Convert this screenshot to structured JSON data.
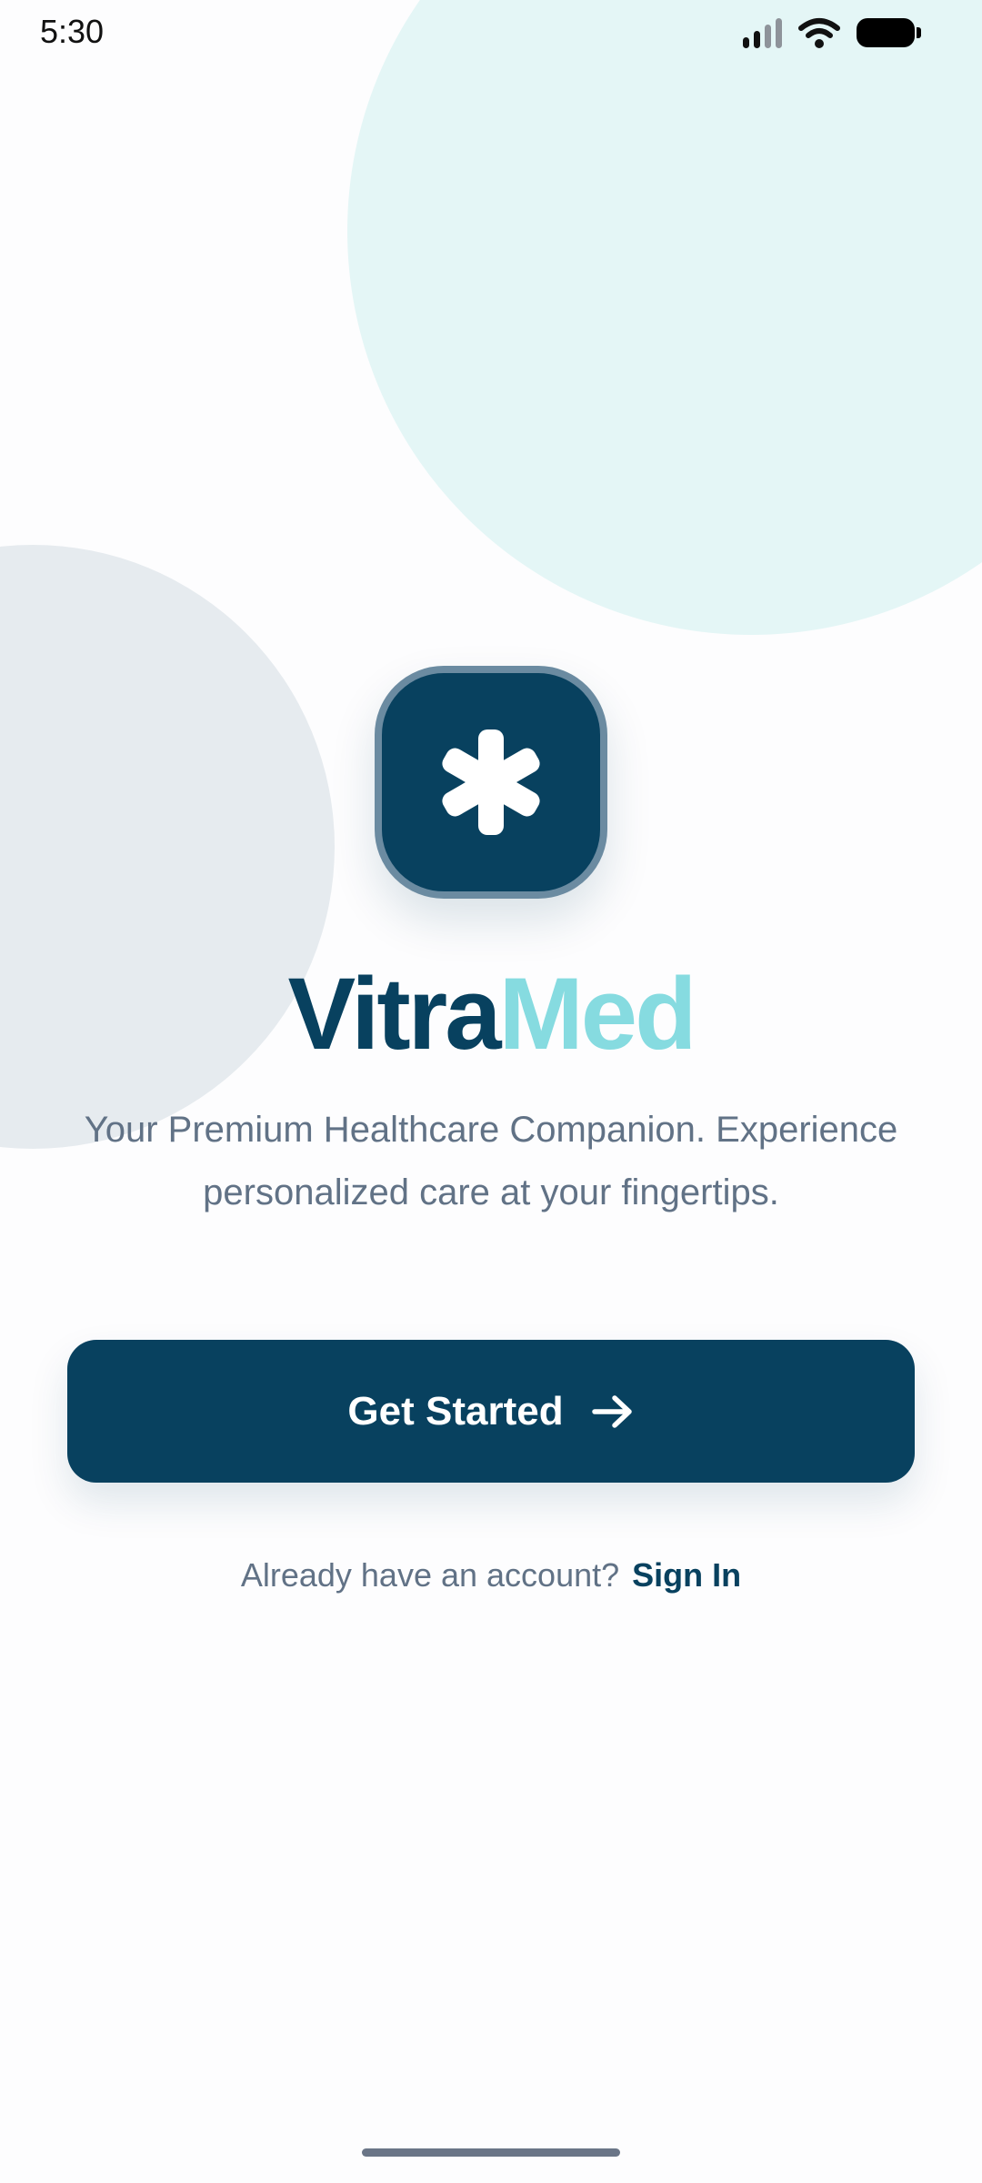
{
  "status_bar": {
    "time": "5:30",
    "icons": [
      "signal-icon",
      "wifi-icon",
      "battery-icon"
    ]
  },
  "logo": {
    "icon": "medical-asterisk-icon"
  },
  "brand": {
    "part1": "Vitra",
    "part2": "Med"
  },
  "tagline": "Your Premium Healthcare Companion. Experience personalized care at your fingertips.",
  "cta": {
    "label": "Get Started",
    "icon": "arrow-right-icon"
  },
  "signin": {
    "prompt": "Already have an account?",
    "link": "Sign In"
  },
  "colors": {
    "primary": "#08415f",
    "accent": "#86dbe0",
    "text_muted": "#617286",
    "bg_circle_teal": "#e4f6f6",
    "bg_circle_gray": "#e6ebef"
  }
}
